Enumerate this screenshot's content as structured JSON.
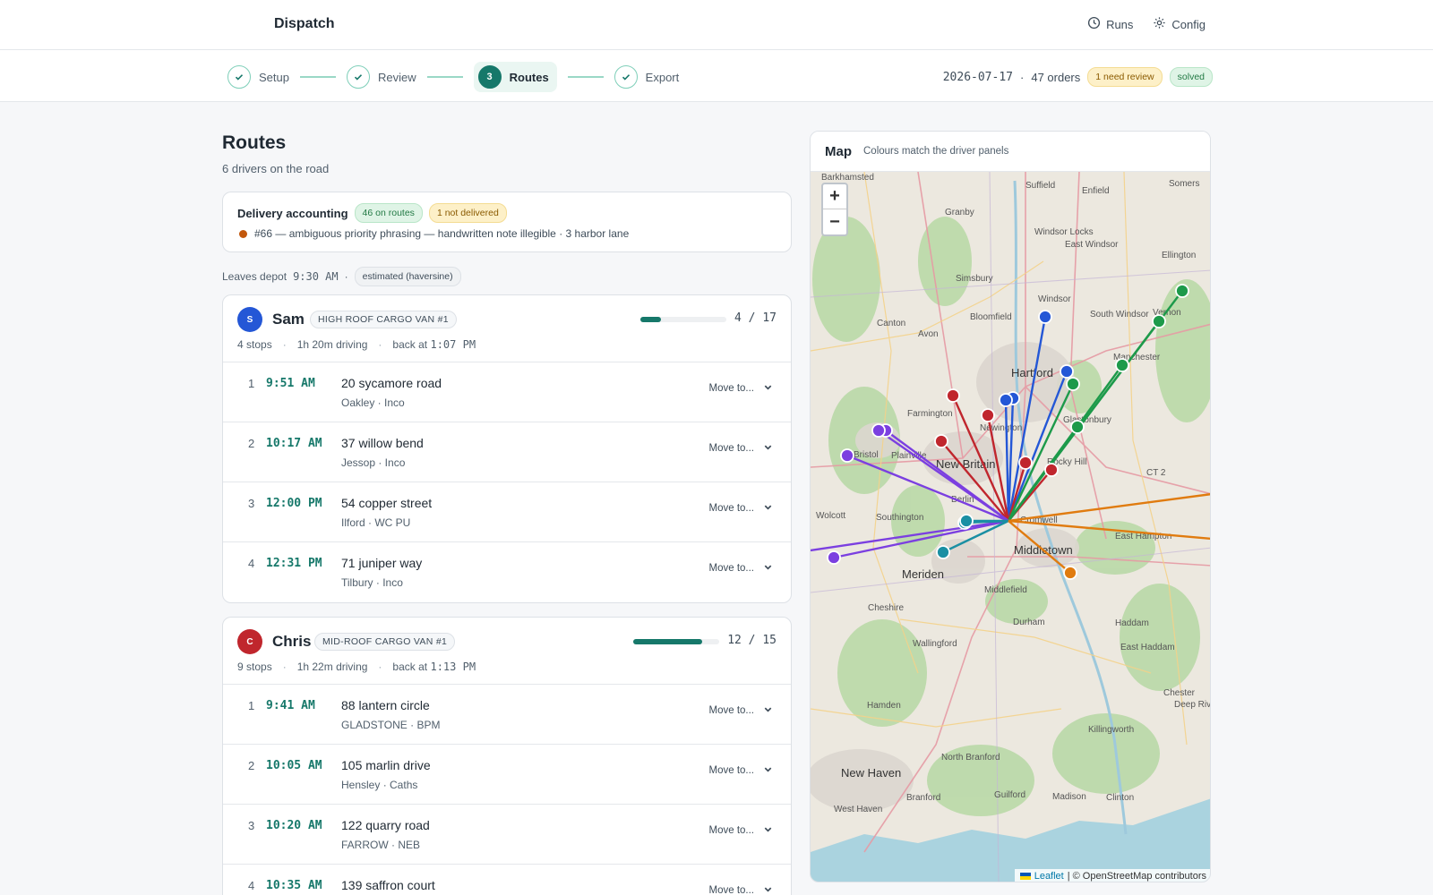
{
  "app": {
    "title": "Dispatch"
  },
  "topnav": {
    "runs": "Runs",
    "config": "Config"
  },
  "steps": [
    {
      "label": "Setup",
      "state": "done"
    },
    {
      "label": "Review",
      "state": "done"
    },
    {
      "label": "Routes",
      "state": "active",
      "number": "3"
    },
    {
      "label": "Export",
      "state": "done"
    }
  ],
  "run_meta": {
    "date": "2026-07-17",
    "orders": "47 orders",
    "review_badge": "1 need review",
    "status_badge": "solved"
  },
  "page": {
    "title": "Routes",
    "subtitle": "6 drivers on the road"
  },
  "accounting": {
    "title": "Delivery accounting",
    "on_routes": "46 on routes",
    "not_delivered": "1 not delivered",
    "issue": "#66 — ambiguous priority phrasing — handwritten note illegible · 3 harbor lane"
  },
  "departure": {
    "label": "Leaves depot",
    "time": "9:30 AM",
    "method": "estimated (haversine)"
  },
  "drivers": [
    {
      "initial": "S",
      "name": "Sam",
      "vehicle": "HIGH ROOF CARGO VAN #1",
      "color": "#2457d6",
      "stops_count": "4 stops",
      "driving": "1h 20m driving",
      "back_label": "back at",
      "back_time": "1:07 PM",
      "load": "4 / 17",
      "load_fraction": 0.235,
      "stops": [
        {
          "num": "1",
          "eta": "9:51 AM",
          "address": "20 sycamore road",
          "meta": "Oakley · Inco",
          "move": "Move to..."
        },
        {
          "num": "2",
          "eta": "10:17 AM",
          "address": "37 willow bend",
          "meta": "Jessop · Inco",
          "move": "Move to..."
        },
        {
          "num": "3",
          "eta": "12:00 PM",
          "address": "54 copper street",
          "meta": "Ilford · WC PU",
          "move": "Move to..."
        },
        {
          "num": "4",
          "eta": "12:31 PM",
          "address": "71 juniper way",
          "meta": "Tilbury · Inco",
          "move": "Move to..."
        }
      ]
    },
    {
      "initial": "C",
      "name": "Chris",
      "vehicle": "MID-ROOF CARGO VAN #1",
      "color": "#c0262d",
      "stops_count": "9 stops",
      "driving": "1h 22m driving",
      "back_label": "back at",
      "back_time": "1:13 PM",
      "load": "12 / 15",
      "load_fraction": 0.8,
      "stops": [
        {
          "num": "1",
          "eta": "9:41 AM",
          "address": "88 lantern circle",
          "meta": "GLADSTONE · BPM",
          "move": "Move to..."
        },
        {
          "num": "2",
          "eta": "10:05 AM",
          "address": "105 marlin drive",
          "meta": "Hensley · Caths",
          "move": "Move to..."
        },
        {
          "num": "3",
          "eta": "10:20 AM",
          "address": "122 quarry road",
          "meta": "FARROW · NEB",
          "move": "Move to..."
        },
        {
          "num": "4",
          "eta": "10:35 AM",
          "address": "139 saffron court",
          "meta": "",
          "move": "Move to..."
        }
      ]
    }
  ],
  "map": {
    "title": "Map",
    "subtitle": "Colours match the driver panels",
    "zoom_in": "+",
    "zoom_out": "−",
    "attribution_link": "Leaflet",
    "attribution_text": "| © OpenStreetMap contributors",
    "places": [
      "Suffield",
      "Enfield",
      "Somers",
      "Granby",
      "Windsor Locks",
      "East Windsor",
      "Ellington",
      "Simsbury",
      "Windsor",
      "Vernon",
      "Canton",
      "Bloomfield",
      "South Windsor",
      "Avon",
      "Hartford",
      "Manchester",
      "Farmington",
      "Glastonbury",
      "Newington",
      "Bristol",
      "Plainville",
      "New Britain",
      "Rocky Hill",
      "CT 2",
      "Berlin",
      "Wolcott",
      "Southington",
      "Cromwell",
      "East Hampton",
      "Meriden",
      "Middletown",
      "Cheshire",
      "Middlefield",
      "Durham",
      "Haddam",
      "Wallingford",
      "East Haddam",
      "Hamden",
      "Chester",
      "Deep River",
      "Killingworth",
      "North Branford",
      "New Haven",
      "Branford",
      "Guilford",
      "Madison",
      "Clinton",
      "West Haven",
      "Barkhamsted"
    ],
    "route_colors": {
      "sam": "#2457d6",
      "chris": "#c0262d",
      "green": "#1d9a4a",
      "purple": "#7b3fe0",
      "teal": "#1a8fa3",
      "orange": "#e07b0f"
    }
  }
}
